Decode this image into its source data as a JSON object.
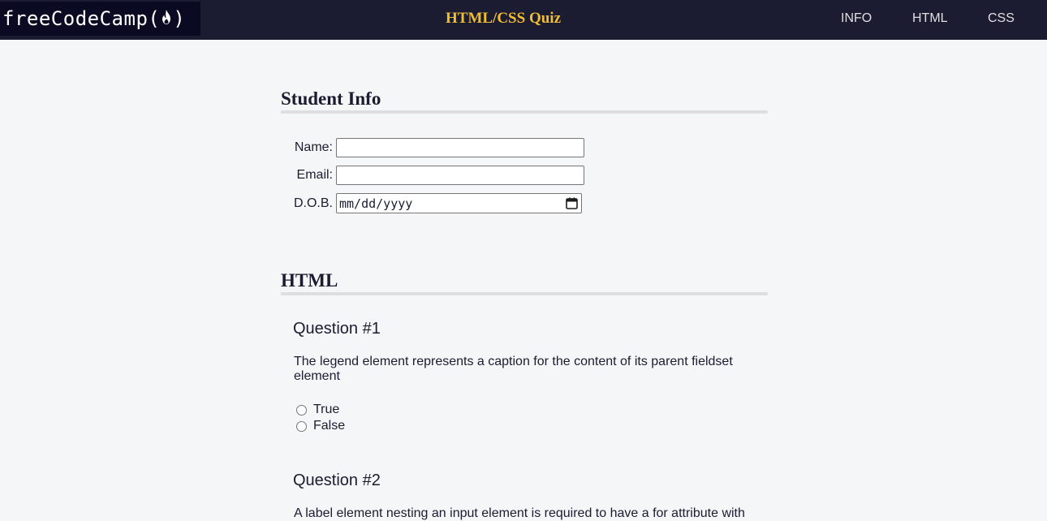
{
  "header": {
    "logo_text_left": "freeCodeCamp(",
    "logo_text_right": ")",
    "title": "HTML/CSS Quiz",
    "nav": [
      "INFO",
      "HTML",
      "CSS"
    ]
  },
  "student_info": {
    "heading": "Student Info",
    "name_label": "Name:",
    "email_label": "Email:",
    "dob_label": "D.O.B.",
    "dob_placeholder": "mm/dd/yyyy"
  },
  "html_section": {
    "heading": "HTML",
    "questions": [
      {
        "title": "Question #1",
        "text": "The legend element represents a caption for the content of its parent fieldset element",
        "options": [
          "True",
          "False"
        ]
      },
      {
        "title": "Question #2",
        "text": "A label element nesting an input element is required to have a for attribute with"
      }
    ]
  },
  "colors": {
    "header_bg": "#1b1b32",
    "title_accent": "#f1be32",
    "page_bg": "#f5f6f7"
  }
}
